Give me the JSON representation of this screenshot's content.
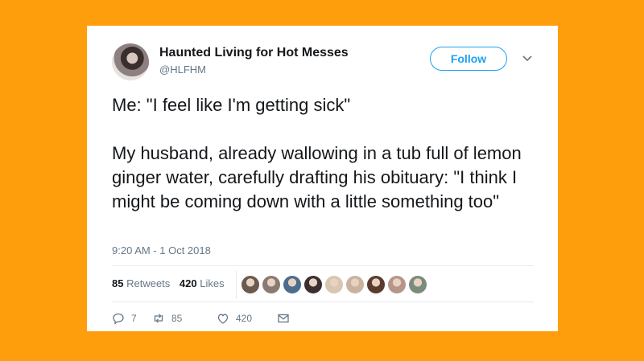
{
  "tweet": {
    "author_name": "Haunted Living for Hot Messes",
    "handle": "@HLFHM",
    "follow_label": "Follow",
    "paragraph1": "Me: \"I feel like I'm getting sick\"",
    "paragraph2": "My husband, already wallowing in a tub full of lemon ginger water, carefully drafting his obituary: \"I think I might be coming down with a little something too\"",
    "timestamp": "9:20 AM - 1 Oct 2018"
  },
  "stats": {
    "retweets_count": "85",
    "retweets_label": "Retweets",
    "likes_count": "420",
    "likes_label": "Likes"
  },
  "liker_avatars": [
    {
      "name": "avatar-1",
      "color": "#6b5a4e"
    },
    {
      "name": "avatar-2",
      "color": "#8a7a74"
    },
    {
      "name": "avatar-3",
      "color": "#4d6d8c"
    },
    {
      "name": "avatar-4",
      "color": "#3a3030"
    },
    {
      "name": "avatar-5",
      "color": "#d8c6b0"
    },
    {
      "name": "avatar-6",
      "color": "#c9b3a0"
    },
    {
      "name": "avatar-7",
      "color": "#5a3b2e"
    },
    {
      "name": "avatar-8",
      "color": "#b8958a"
    },
    {
      "name": "avatar-9",
      "color": "#7b8c7e"
    }
  ],
  "actions": {
    "reply_count": "7",
    "retweet_count": "85",
    "like_count": "420"
  },
  "colors": {
    "background": "#FF9E0D",
    "accent": "#1DA1F2",
    "muted": "#657786",
    "text": "#14171a"
  }
}
